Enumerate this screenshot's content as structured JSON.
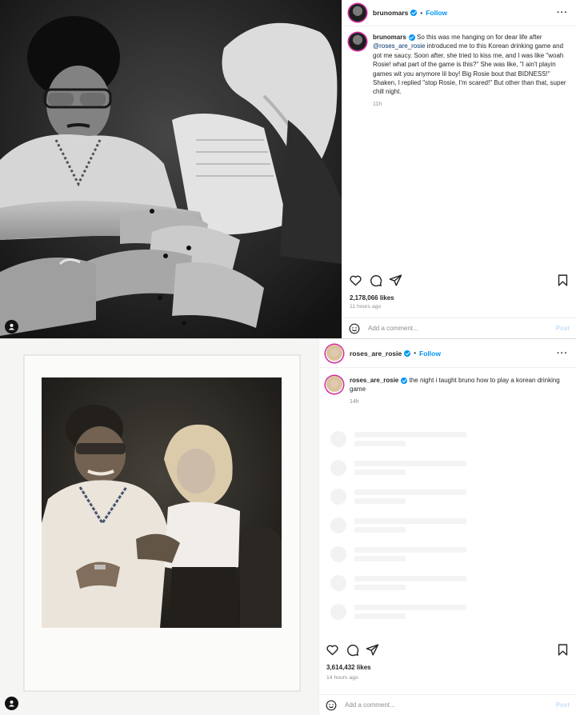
{
  "post1": {
    "username": "brunomars",
    "follow_label": "Follow",
    "separator": "•",
    "more_label": "···",
    "caption_user": "brunomars",
    "caption_before": " So this was me hanging on for dear life after ",
    "caption_mention": "@roses_are_rosie",
    "caption_after": " introduced me to this Korean drinking game and got me saucy. Soon after, she tried to kiss me, and I was like \"woah Rosie! what part of the game is this?\" She was like, \"I ain't playin games wit you anymore lil boy! Big Rosie bout that BIDNESS!\" Shaken, I replied \"stop Rosie, I'm scared!\" But other than that, super chill night.",
    "caption_time": "11h",
    "likes": "2,178,066 likes",
    "time_ago": "11 hours ago",
    "comment_placeholder": "Add a comment...",
    "post_button": "Post"
  },
  "post2": {
    "username": "roses_are_rosie",
    "follow_label": "Follow",
    "separator": "•",
    "more_label": "···",
    "caption_user": "roses_are_rosie",
    "caption_text": " the night i taught bruno how to play a korean drinking game",
    "caption_time": "14h",
    "likes": "3,614,432 likes",
    "time_ago": "14 hours ago",
    "comment_placeholder": "Add a comment...",
    "post_button": "Post"
  },
  "icons": [
    "heart-icon",
    "comment-icon",
    "share-icon",
    "bookmark-icon",
    "emoji-icon",
    "user-tag-icon",
    "verified-badge-icon"
  ],
  "colors": {
    "link": "#0095f6",
    "mention": "#00376b",
    "muted": "#8e8e8e",
    "text": "#262626"
  }
}
